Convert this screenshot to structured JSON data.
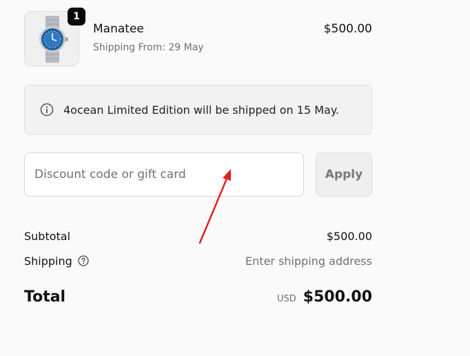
{
  "product": {
    "name": "Manatee",
    "shipping_note": "Shipping From: 29 May",
    "price": "$500.00",
    "quantity": "1",
    "image_icon": "watch-icon"
  },
  "notice": {
    "icon": "info-icon",
    "text": "4ocean Limited Edition will be shipped on 15 May."
  },
  "discount": {
    "placeholder": "Discount code or gift card",
    "value": "",
    "apply_label": "Apply"
  },
  "summary": {
    "subtotal_label": "Subtotal",
    "subtotal_value": "$500.00",
    "shipping_label": "Shipping",
    "shipping_help_icon": "question-circle-icon",
    "shipping_value": "Enter shipping address",
    "total_label": "Total",
    "currency": "USD",
    "total_value": "$500.00"
  },
  "annotation": {
    "arrow_icon": "red-arrow-icon",
    "color": "#e02020"
  },
  "colors": {
    "background": "#fafafa",
    "muted_text": "#707070",
    "badge": "#0a0a0a"
  }
}
